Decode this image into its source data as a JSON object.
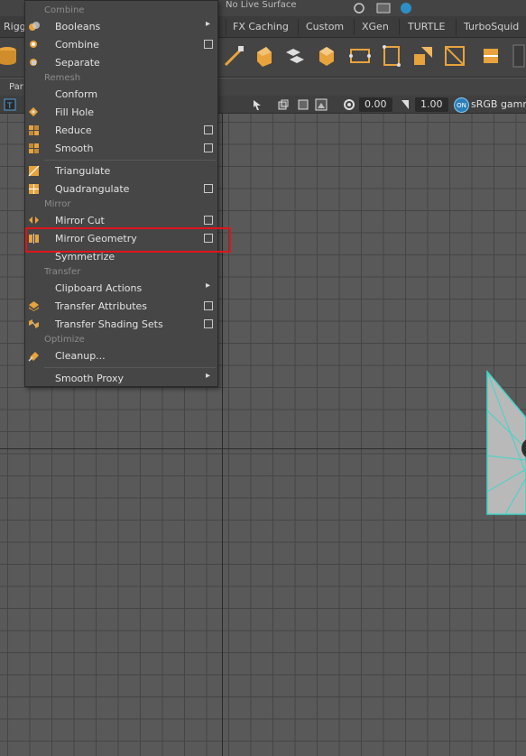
{
  "top_bar": {
    "status_text": "No Live Surface"
  },
  "shelf_tabs": [
    "Rigg",
    "FX Caching",
    "Custom",
    "XGen",
    "TURTLE",
    "TurboSquid"
  ],
  "panel_bar": {
    "label": "Par"
  },
  "view_toolbar": {
    "value_a": "0.00",
    "value_b": "1.00",
    "on_badge": "ON",
    "color_space": "sRGB gamm"
  },
  "menu": {
    "sections": {
      "combine": "Combine",
      "remesh": "Remesh",
      "mirror": "Mirror",
      "transfer": "Transfer",
      "optimize": "Optimize"
    },
    "items": {
      "booleans": "Booleans",
      "combine": "Combine",
      "separate": "Separate",
      "conform": "Conform",
      "fill_hole": "Fill Hole",
      "reduce": "Reduce",
      "smooth": "Smooth",
      "triangulate": "Triangulate",
      "quadrangulate": "Quadrangulate",
      "mirror_cut": "Mirror Cut",
      "mirror_geometry": "Mirror Geometry",
      "symmetrize": "Symmetrize",
      "clipboard_actions": "Clipboard Actions",
      "transfer_attributes": "Transfer Attributes",
      "transfer_shading_sets": "Transfer Shading Sets",
      "cleanup": "Cleanup...",
      "smooth_proxy": "Smooth Proxy"
    },
    "submenu_arrow": "▸"
  },
  "colors": {
    "highlight_box": "#e0141c",
    "mesh_edge": "#3fd6c8",
    "mesh_fill": "#b9b9b9",
    "icon_orange": "#e8a33c"
  }
}
